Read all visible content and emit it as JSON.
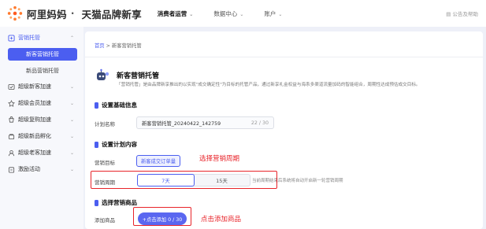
{
  "header": {
    "brand": "阿里妈妈",
    "separator": "·",
    "product": "天猫品牌新享",
    "nav": [
      {
        "label": "消费者运营",
        "active": true
      },
      {
        "label": "数据中心",
        "active": false
      },
      {
        "label": "账户",
        "active": false
      }
    ],
    "help_label": "公告及帮助"
  },
  "sidebar": {
    "groups": [
      {
        "label": "营销托管",
        "icon": "manage-icon",
        "expanded": true
      },
      {
        "label": "超级新客加速",
        "icon": "rocket-icon"
      },
      {
        "label": "超级会员加速",
        "icon": "member-icon"
      },
      {
        "label": "超级复购加速",
        "icon": "repurchase-icon"
      },
      {
        "label": "超级新品孵化",
        "icon": "new-product-icon"
      },
      {
        "label": "超级老客加速",
        "icon": "old-customer-icon"
      },
      {
        "label": "激励活动",
        "icon": "gift-icon"
      }
    ],
    "sub_items": [
      {
        "label": "新客营销托管",
        "active": true
      },
      {
        "label": "新品营销托管",
        "active": false
      }
    ]
  },
  "breadcrumb": {
    "home": "首页",
    "separator": ">",
    "current": "新客营销托管"
  },
  "page": {
    "title": "新客营销托管",
    "description": "「营销托管」是由品牌新享推出的以实现\"成交确定性\"为目标的托管产品，通过新享礼金权益与海系多渠道流量加码的智能组合，周期性达成预估成交目标。"
  },
  "sections": {
    "basic_info": "设置基础信息",
    "plan_content": "设置计划内容",
    "products": "选择营销商品"
  },
  "form": {
    "plan_name_label": "计划名称",
    "plan_name_value": "新客营销托管_20240422_142759",
    "plan_name_count": "22 / 30",
    "goal_label": "营销目标",
    "goal_value": "新客成交订单量",
    "period_label": "营销周期",
    "period_options": [
      {
        "label": "7天",
        "active": true
      },
      {
        "label": "15天",
        "active": false
      }
    ],
    "period_note": "当前周期结束后系统将自动开启新一轮营销周期",
    "product_label": "添加商品",
    "add_button": "+点击添加 0 / 30"
  },
  "annotations": {
    "period": "选择营销周期",
    "add_product": "点击添加商品"
  },
  "colors": {
    "accent": "#4b5ef0",
    "annotation_red": "#e8242a"
  }
}
